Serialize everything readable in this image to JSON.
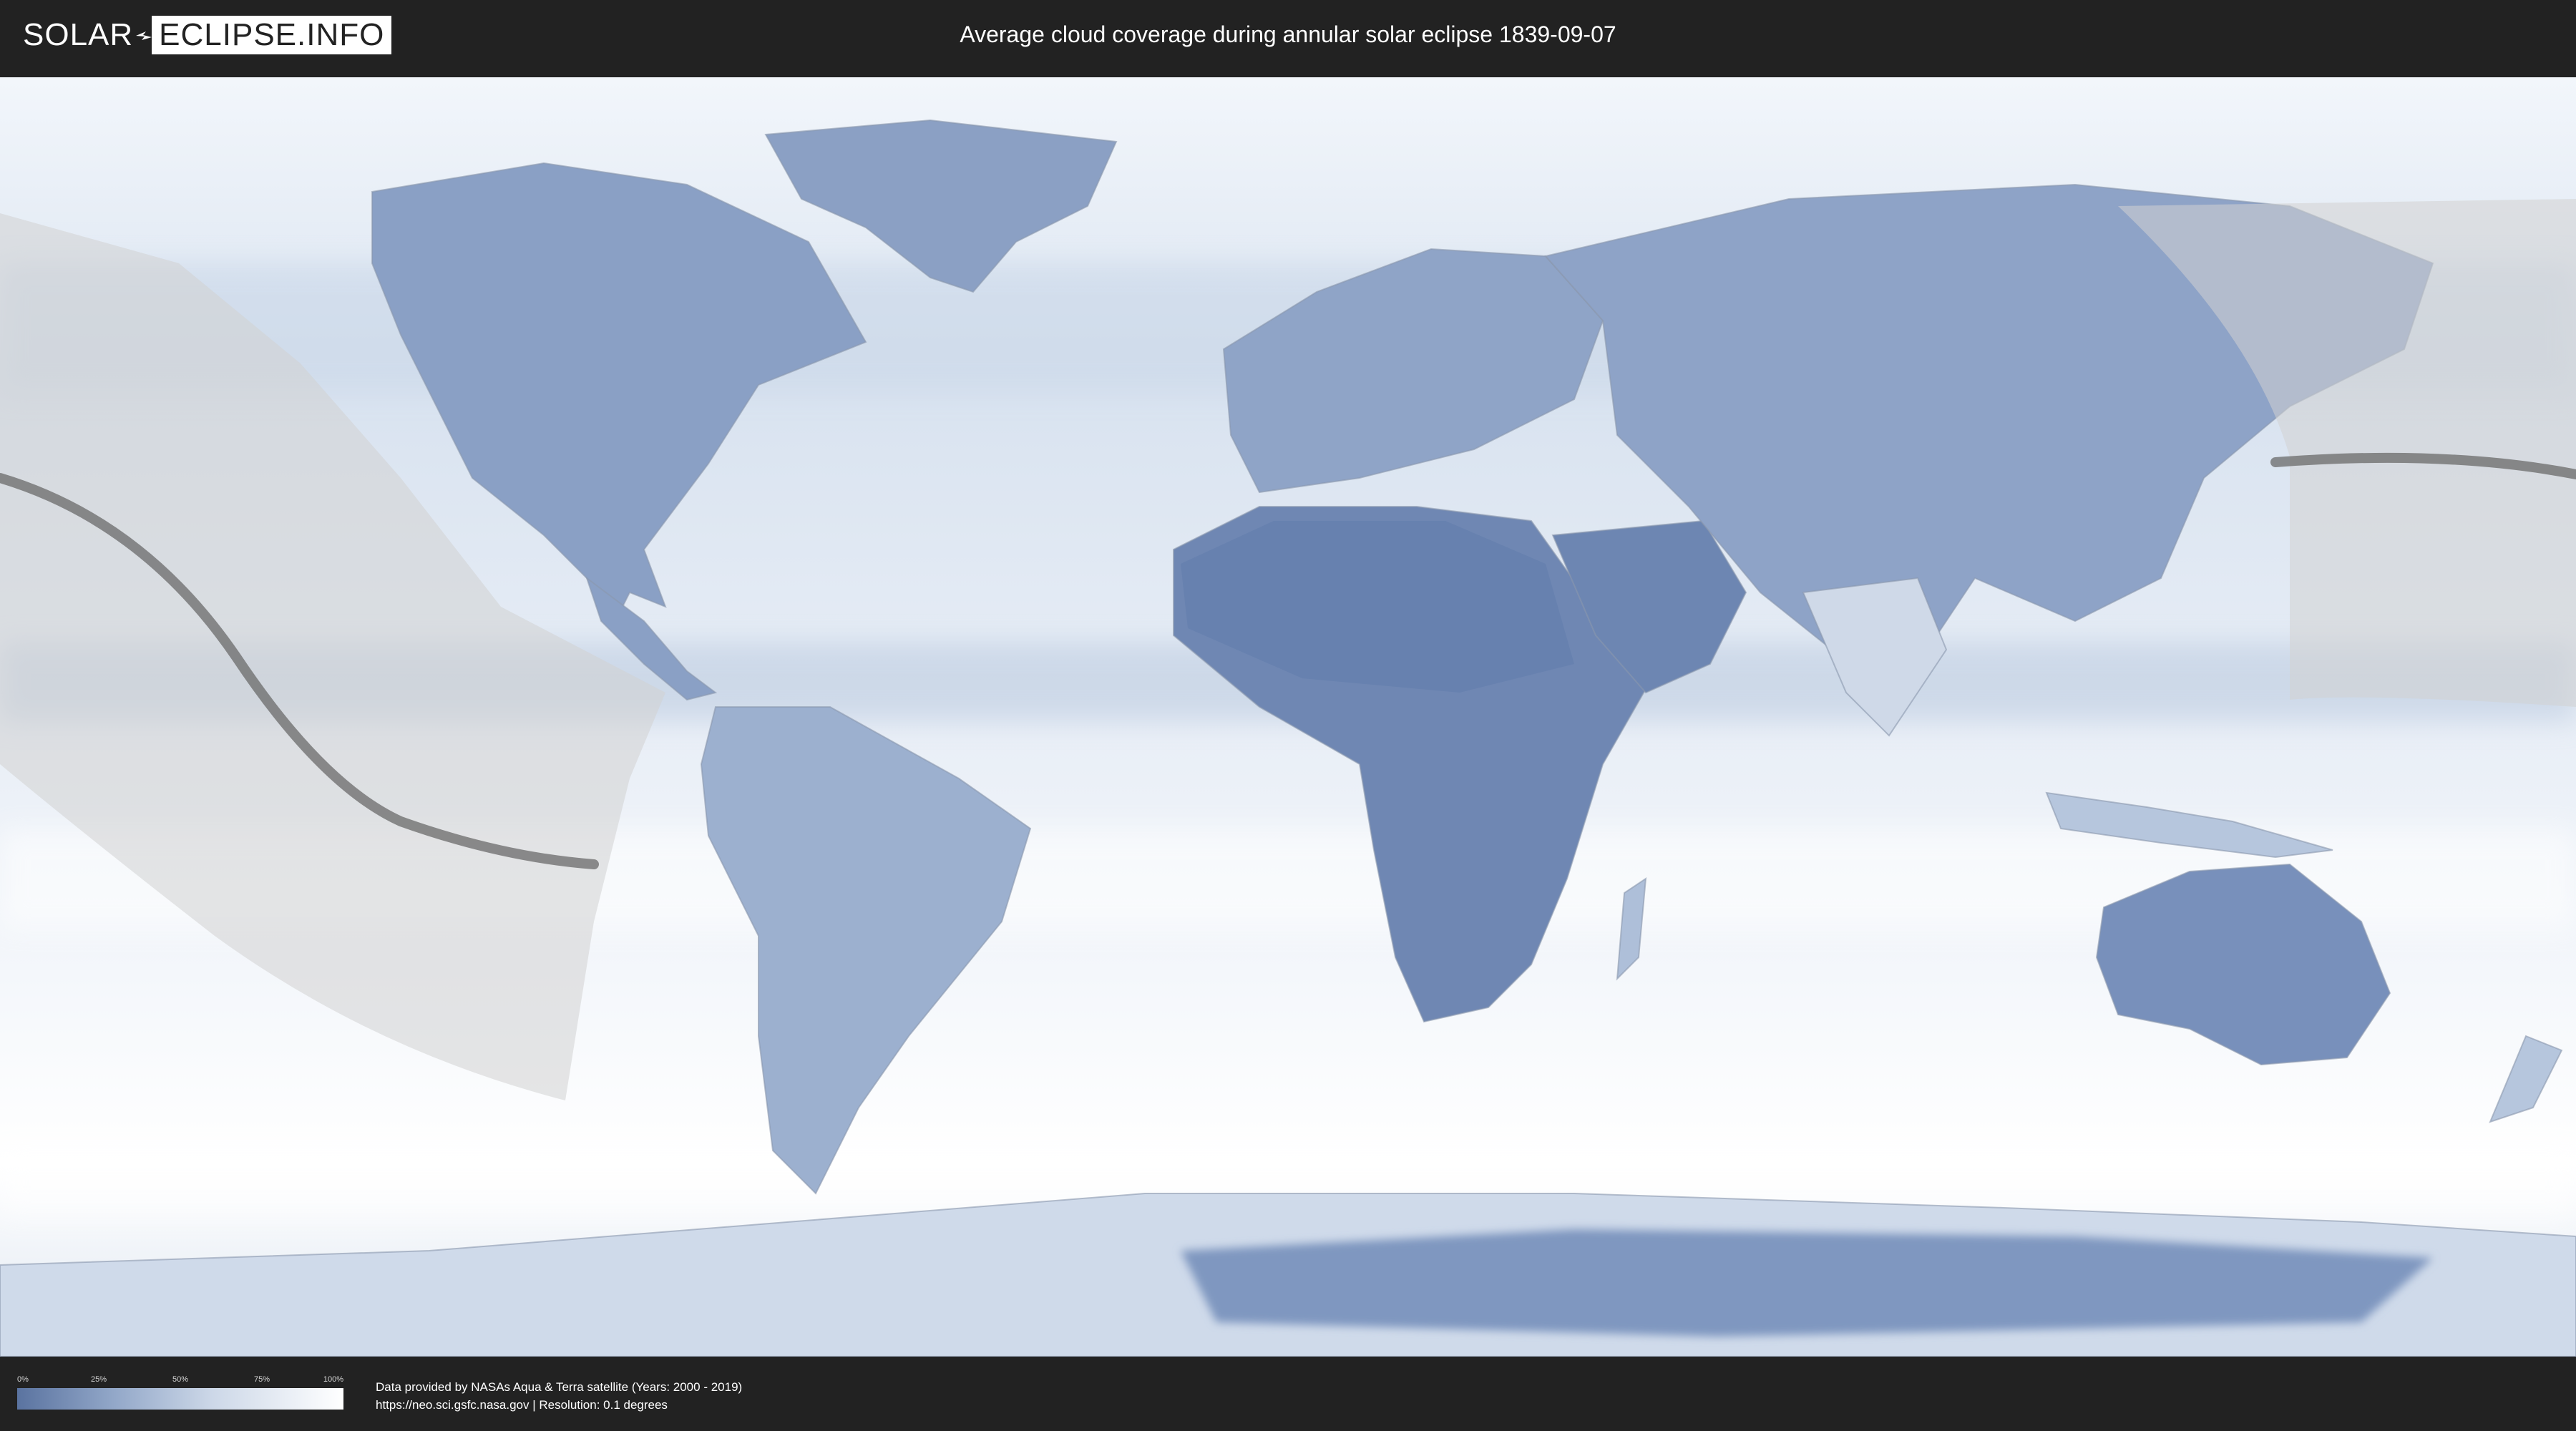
{
  "header": {
    "logo_solar": "SOLAR",
    "logo_eclipse": "ECLIPSE.INFO",
    "title": "Average cloud coverage during annular solar eclipse 1839-09-07"
  },
  "legend": {
    "ticks": [
      "0%",
      "25%",
      "50%",
      "75%",
      "100%"
    ],
    "colors": {
      "low": "#5a73a0",
      "mid": "#cdd8e8",
      "high": "#ffffff"
    }
  },
  "credits": {
    "line1": "Data provided by NASAs Aqua & Terra satellite (Years: 2000 - 2019)",
    "line2": "https://neo.sci.gsfc.nasa.gov | Resolution: 0.1 degrees"
  },
  "map": {
    "ocean_color": "#e3ecf6",
    "land_color": "#6f88b4",
    "eclipse_overlay_color": "#d2d2d2",
    "eclipse_path_color": "#6a6a6a"
  }
}
